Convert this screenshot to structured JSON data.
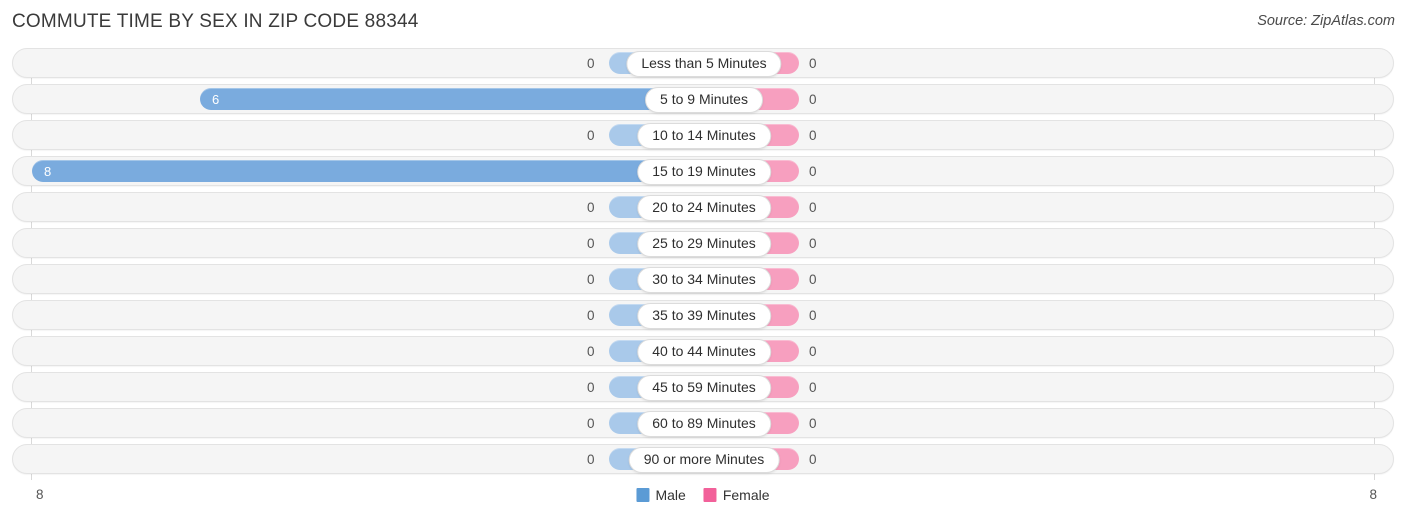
{
  "header": {
    "title": "COMMUTE TIME BY SEX IN ZIP CODE 88344",
    "source": "Source: ZipAtlas.com"
  },
  "legend": {
    "male_label": "Male",
    "female_label": "Female",
    "male_color": "#5b9bd5",
    "female_color": "#f2619a"
  },
  "axis": {
    "left_tick": "8",
    "right_tick": "8"
  },
  "chart_data": {
    "type": "bar",
    "orientation": "horizontal-diverging",
    "title": "COMMUTE TIME BY SEX IN ZIP CODE 88344",
    "xlabel": "",
    "ylabel": "",
    "xlim": [
      8,
      8
    ],
    "grid": false,
    "legend_position": "bottom-center",
    "categories": [
      "Less than 5 Minutes",
      "5 to 9 Minutes",
      "10 to 14 Minutes",
      "15 to 19 Minutes",
      "20 to 24 Minutes",
      "25 to 29 Minutes",
      "30 to 34 Minutes",
      "35 to 39 Minutes",
      "40 to 44 Minutes",
      "45 to 59 Minutes",
      "60 to 89 Minutes",
      "90 or more Minutes"
    ],
    "series": [
      {
        "name": "Male",
        "color": "#5b9bd5",
        "values": [
          0,
          6,
          0,
          8,
          0,
          0,
          0,
          0,
          0,
          0,
          0,
          0
        ],
        "labels": [
          "0",
          "6",
          "0",
          "8",
          "0",
          "0",
          "0",
          "0",
          "0",
          "0",
          "0",
          "0"
        ]
      },
      {
        "name": "Female",
        "color": "#f2619a",
        "values": [
          0,
          0,
          0,
          0,
          0,
          0,
          0,
          0,
          0,
          0,
          0,
          0
        ],
        "labels": [
          "0",
          "0",
          "0",
          "0",
          "0",
          "0",
          "0",
          "0",
          "0",
          "0",
          "0",
          "0"
        ]
      }
    ]
  }
}
